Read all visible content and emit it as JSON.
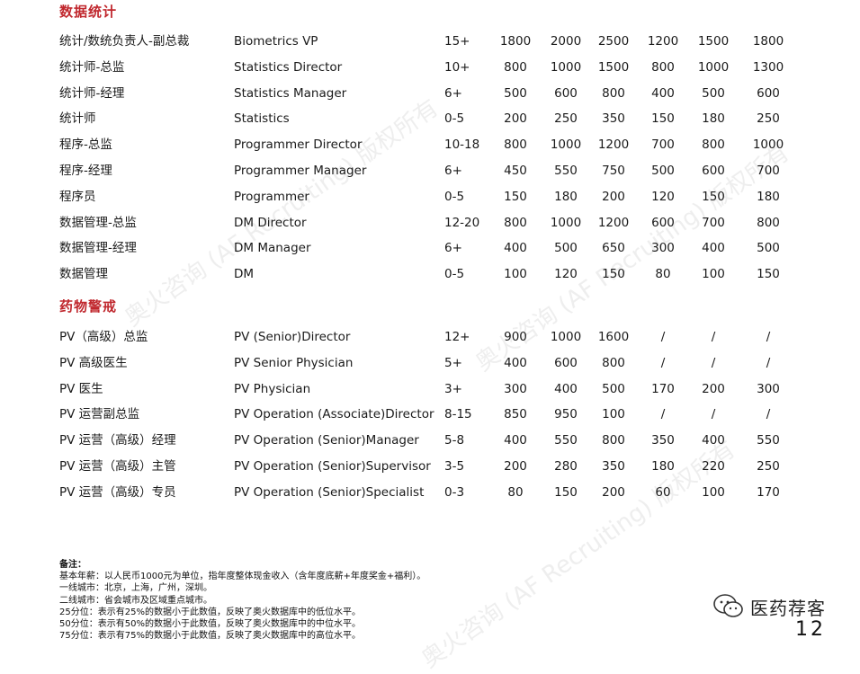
{
  "sections": [
    {
      "title": "数据统计",
      "rows": [
        {
          "cn": "统计/数统负责人-副总裁",
          "en": "Biometrics VP",
          "years": "15+",
          "v": [
            "1800",
            "2000",
            "2500",
            "1200",
            "1500",
            "1800"
          ]
        },
        {
          "cn": "统计师-总监",
          "en": "Statistics Director",
          "years": "10+",
          "v": [
            "800",
            "1000",
            "1500",
            "800",
            "1000",
            "1300"
          ]
        },
        {
          "cn": "统计师-经理",
          "en": "Statistics Manager",
          "years": "6+",
          "v": [
            "500",
            "600",
            "800",
            "400",
            "500",
            "600"
          ]
        },
        {
          "cn": "统计师",
          "en": "Statistics",
          "years": "0-5",
          "v": [
            "200",
            "250",
            "350",
            "150",
            "180",
            "250"
          ]
        },
        {
          "cn": "程序-总监",
          "en": "Programmer Director",
          "years": "10-18",
          "v": [
            "800",
            "1000",
            "1200",
            "700",
            "800",
            "1000"
          ]
        },
        {
          "cn": "程序-经理",
          "en": "Programmer Manager",
          "years": "6+",
          "v": [
            "450",
            "550",
            "750",
            "500",
            "600",
            "700"
          ]
        },
        {
          "cn": "程序员",
          "en": "Programmer",
          "years": "0-5",
          "v": [
            "150",
            "180",
            "200",
            "120",
            "150",
            "180"
          ]
        },
        {
          "cn": "数据管理-总监",
          "en": "DM Director",
          "years": "12-20",
          "v": [
            "800",
            "1000",
            "1200",
            "600",
            "700",
            "800"
          ]
        },
        {
          "cn": "数据管理-经理",
          "en": "DM Manager",
          "years": "6+",
          "v": [
            "400",
            "500",
            "650",
            "300",
            "400",
            "500"
          ]
        },
        {
          "cn": "数据管理",
          "en": "DM",
          "years": "0-5",
          "v": [
            "100",
            "120",
            "150",
            "80",
            "100",
            "150"
          ]
        }
      ]
    },
    {
      "title": "药物警戒",
      "rows": [
        {
          "cn": "PV（高级）总监",
          "en": "PV (Senior)Director",
          "years": "12+",
          "v": [
            "900",
            "1000",
            "1600",
            "/",
            "/",
            "/"
          ]
        },
        {
          "cn": "PV 高级医生",
          "en": "PV Senior Physician",
          "years": "5+",
          "v": [
            "400",
            "600",
            "800",
            "/",
            "/",
            "/"
          ]
        },
        {
          "cn": "PV 医生",
          "en": "PV Physician",
          "years": "3+",
          "v": [
            "300",
            "400",
            "500",
            "170",
            "200",
            "300"
          ]
        },
        {
          "cn": "PV 运营副总监",
          "en": "PV Operation (Associate)Director",
          "years": "8-15",
          "v": [
            "850",
            "950",
            "100",
            "/",
            "/",
            "/"
          ]
        },
        {
          "cn": "PV 运营（高级）经理",
          "en": "PV Operation (Senior)Manager",
          "years": "5-8",
          "v": [
            "400",
            "550",
            "800",
            "350",
            "400",
            "550"
          ]
        },
        {
          "cn": "PV 运营（高级）主管",
          "en": "PV Operation (Senior)Supervisor",
          "years": "3-5",
          "v": [
            "200",
            "280",
            "350",
            "180",
            "220",
            "250"
          ]
        },
        {
          "cn": "PV 运营（高级）专员",
          "en": "PV Operation (Senior)Specialist",
          "years": "0-3",
          "v": [
            "80",
            "150",
            "200",
            "60",
            "100",
            "170"
          ]
        }
      ]
    }
  ],
  "notes": {
    "title": "备注：",
    "lines": [
      "基本年薪：以人民币1000元为单位，指年度整体现金收入（含年度底薪+年度奖金+福利）。",
      "一线城市：北京，上海，广州，深圳。",
      "二线城市：省会城市及区域重点城市。",
      "25分位：表示有25%的数据小于此数值，反映了奥火数据库中的低位水平。",
      "50分位：表示有50%的数据小于此数值，反映了奥火数据库中的中位水平。",
      "75分位：表示有75%的数据小于此数值，反映了奥火数据库中的高位水平。"
    ]
  },
  "watermark": "奥火咨询 (AF Recruiting) 版权所有",
  "brand": {
    "name": "医药荐客",
    "icon": "wechat-icon"
  },
  "page_number": "12",
  "colors": {
    "accent": "#c0272d",
    "text": "#1a1a1a"
  }
}
